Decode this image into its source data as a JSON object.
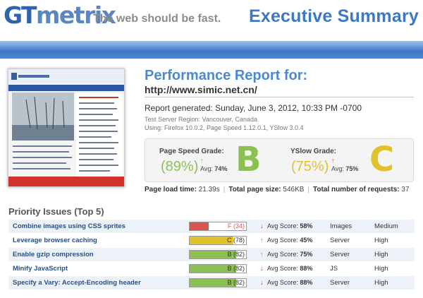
{
  "header": {
    "logo_part1": "GT",
    "logo_part2": "metrix",
    "tagline": "The web should be fast.",
    "section_title": "Executive Summary"
  },
  "report": {
    "title": "Performance Report for:",
    "url": "http://www.simic.net.cn/",
    "generated": "Report generated: Sunday, June 3, 2012, 10:33 PM -0700",
    "region": "Test Server Region: Vancouver, Canada",
    "using": "Using: Firefox 10.0.2, Page Speed 1.12.0.1, YSlow 3.0.4"
  },
  "grades": {
    "pagespeed": {
      "label": "Page Speed Grade:",
      "percent": "(89%)",
      "avg_label": "Avg:",
      "avg_value": "74%",
      "letter": "B",
      "color": "#8cc152"
    },
    "yslow": {
      "label": "YSlow Grade:",
      "percent": "(75%)",
      "avg_label": "Avg:",
      "avg_value": "75%",
      "letter": "C",
      "color": "#e2c22a"
    }
  },
  "stats": {
    "load_time_label": "Page load time:",
    "load_time": "21.39s",
    "page_size_label": "Total page size:",
    "page_size": "546KB",
    "requests_label": "Total number of requests:",
    "requests": "37"
  },
  "priority": {
    "title": "Priority Issues (Top 5)",
    "issues": [
      {
        "name": "Combine images using CSS sprites",
        "grade": "F (34)",
        "score": 0.34,
        "grade_color": "#d9534f",
        "trend": "down",
        "avg_label": "Avg Score:",
        "avg": "58%",
        "type": "Images",
        "priority": "Medium"
      },
      {
        "name": "Leverage browser caching",
        "grade": "C (78)",
        "score": 0.78,
        "grade_color": "#e2c22a",
        "trend": "up",
        "avg_label": "Avg Score:",
        "avg": "45%",
        "type": "Server",
        "priority": "High"
      },
      {
        "name": "Enable gzip compression",
        "grade": "B (82)",
        "score": 0.82,
        "grade_color": "#8cc152",
        "trend": "up",
        "avg_label": "Avg Score:",
        "avg": "75%",
        "type": "Server",
        "priority": "High"
      },
      {
        "name": "Minify JavaScript",
        "grade": "B (82)",
        "score": 0.82,
        "grade_color": "#8cc152",
        "trend": "down",
        "avg_label": "Avg Score:",
        "avg": "88%",
        "type": "JS",
        "priority": "High"
      },
      {
        "name": "Specify a Vary: Accept-Encoding header",
        "grade": "B (82)",
        "score": 0.82,
        "grade_color": "#8cc152",
        "trend": "down",
        "avg_label": "Avg Score:",
        "avg": "88%",
        "type": "Server",
        "priority": "High"
      }
    ]
  },
  "colors": {
    "brand_blue": "#3d78c4",
    "trend_up": "#6aa84f",
    "trend_down": "#cc3333"
  }
}
